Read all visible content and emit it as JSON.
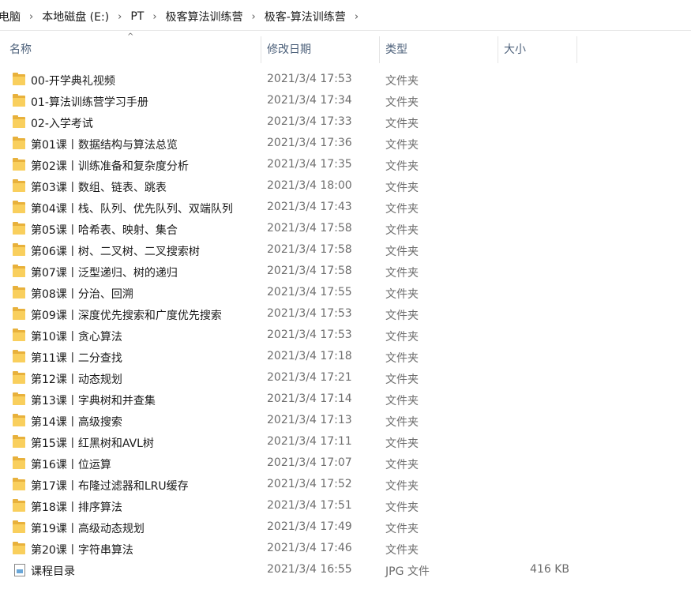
{
  "breadcrumb": {
    "items": [
      "电脑",
      "本地磁盘 (E:)",
      "PT",
      "极客算法训练营",
      "极客-算法训练营"
    ],
    "separator": "›"
  },
  "columns": {
    "name": "名称",
    "date": "修改日期",
    "type": "类型",
    "size": "大小",
    "sort_indicator": "^"
  },
  "files": [
    {
      "icon": "folder-icon",
      "name": "00-开学典礼视频",
      "date": "2021/3/4 17:53",
      "type": "文件夹",
      "size": ""
    },
    {
      "icon": "folder-icon",
      "name": "01-算法训练营学习手册",
      "date": "2021/3/4 17:34",
      "type": "文件夹",
      "size": ""
    },
    {
      "icon": "folder-icon",
      "name": "02-入学考试",
      "date": "2021/3/4 17:33",
      "type": "文件夹",
      "size": ""
    },
    {
      "icon": "folder-icon",
      "name": "第01课丨数据结构与算法总览",
      "date": "2021/3/4 17:36",
      "type": "文件夹",
      "size": ""
    },
    {
      "icon": "folder-icon",
      "name": "第02课丨训练准备和复杂度分析",
      "date": "2021/3/4 17:35",
      "type": "文件夹",
      "size": ""
    },
    {
      "icon": "folder-icon",
      "name": "第03课丨数组、链表、跳表",
      "date": "2021/3/4 18:00",
      "type": "文件夹",
      "size": ""
    },
    {
      "icon": "folder-icon",
      "name": "第04课丨栈、队列、优先队列、双端队列",
      "date": "2021/3/4 17:43",
      "type": "文件夹",
      "size": ""
    },
    {
      "icon": "folder-icon",
      "name": "第05课丨哈希表、映射、集合",
      "date": "2021/3/4 17:58",
      "type": "文件夹",
      "size": ""
    },
    {
      "icon": "folder-icon",
      "name": "第06课丨树、二叉树、二叉搜索树",
      "date": "2021/3/4 17:58",
      "type": "文件夹",
      "size": ""
    },
    {
      "icon": "folder-icon",
      "name": "第07课丨泛型递归、树的递归",
      "date": "2021/3/4 17:58",
      "type": "文件夹",
      "size": ""
    },
    {
      "icon": "folder-icon",
      "name": "第08课丨分治、回溯",
      "date": "2021/3/4 17:55",
      "type": "文件夹",
      "size": ""
    },
    {
      "icon": "folder-icon",
      "name": "第09课丨深度优先搜索和广度优先搜索",
      "date": "2021/3/4 17:53",
      "type": "文件夹",
      "size": ""
    },
    {
      "icon": "folder-icon",
      "name": "第10课丨贪心算法",
      "date": "2021/3/4 17:53",
      "type": "文件夹",
      "size": ""
    },
    {
      "icon": "folder-icon",
      "name": "第11课丨二分查找",
      "date": "2021/3/4 17:18",
      "type": "文件夹",
      "size": ""
    },
    {
      "icon": "folder-icon",
      "name": "第12课丨动态规划",
      "date": "2021/3/4 17:21",
      "type": "文件夹",
      "size": ""
    },
    {
      "icon": "folder-icon",
      "name": "第13课丨字典树和并查集",
      "date": "2021/3/4 17:14",
      "type": "文件夹",
      "size": ""
    },
    {
      "icon": "folder-icon",
      "name": "第14课丨高级搜索",
      "date": "2021/3/4 17:13",
      "type": "文件夹",
      "size": ""
    },
    {
      "icon": "folder-icon",
      "name": "第15课丨红黑树和AVL树",
      "date": "2021/3/4 17:11",
      "type": "文件夹",
      "size": ""
    },
    {
      "icon": "folder-icon",
      "name": "第16课丨位运算",
      "date": "2021/3/4 17:07",
      "type": "文件夹",
      "size": ""
    },
    {
      "icon": "folder-icon",
      "name": "第17课丨布隆过滤器和LRU缓存",
      "date": "2021/3/4 17:52",
      "type": "文件夹",
      "size": ""
    },
    {
      "icon": "folder-icon",
      "name": "第18课丨排序算法",
      "date": "2021/3/4 17:51",
      "type": "文件夹",
      "size": ""
    },
    {
      "icon": "folder-icon",
      "name": "第19课丨高级动态规划",
      "date": "2021/3/4 17:49",
      "type": "文件夹",
      "size": ""
    },
    {
      "icon": "folder-icon",
      "name": "第20课丨字符串算法",
      "date": "2021/3/4 17:46",
      "type": "文件夹",
      "size": ""
    },
    {
      "icon": "image-file-icon",
      "name": "课程目录",
      "date": "2021/3/4 16:55",
      "type": "JPG 文件",
      "size": "416 KB"
    }
  ]
}
